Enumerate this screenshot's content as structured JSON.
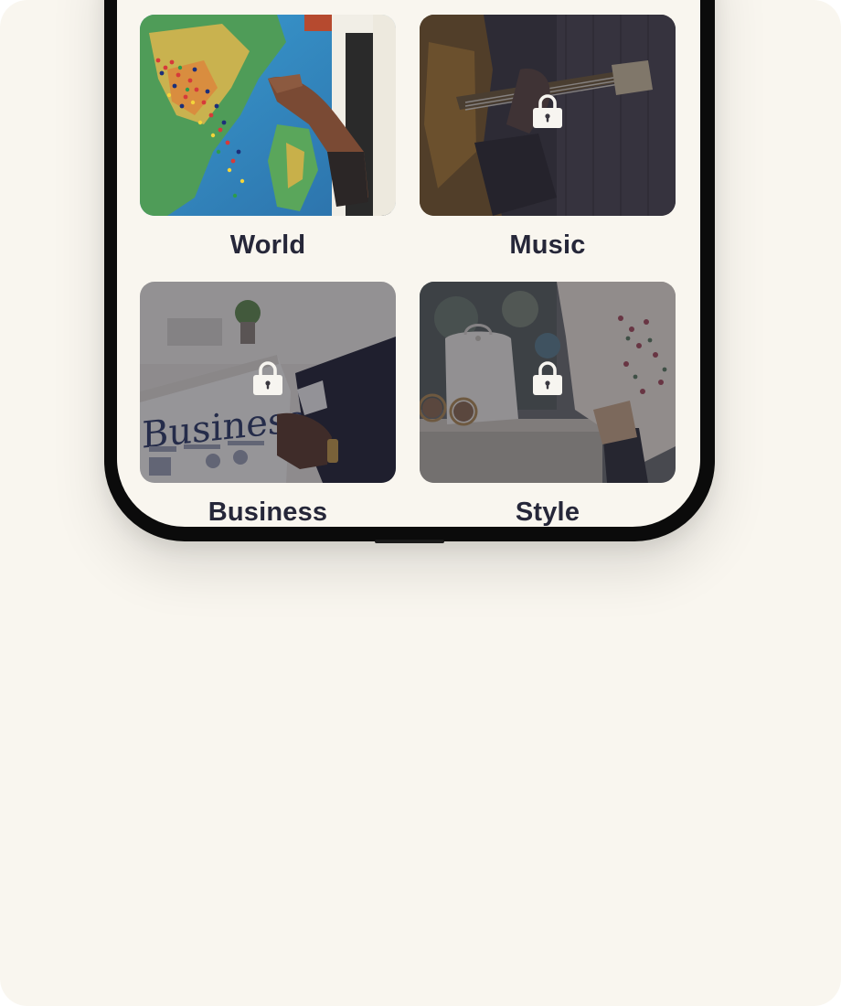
{
  "categories": [
    {
      "label": "World",
      "locked": false,
      "image_icon": "world-map-photo"
    },
    {
      "label": "Music",
      "locked": true,
      "image_icon": "guitar-photo"
    },
    {
      "label": "Business",
      "locked": true,
      "image_icon": "newspaper-photo"
    },
    {
      "label": "Style",
      "locked": true,
      "image_icon": "handbag-photo"
    }
  ],
  "colors": {
    "background": "#f9f6ef",
    "label_text": "#262739",
    "phone_frame": "#0b0b0b",
    "lock_icon": "#f7f5f0"
  }
}
